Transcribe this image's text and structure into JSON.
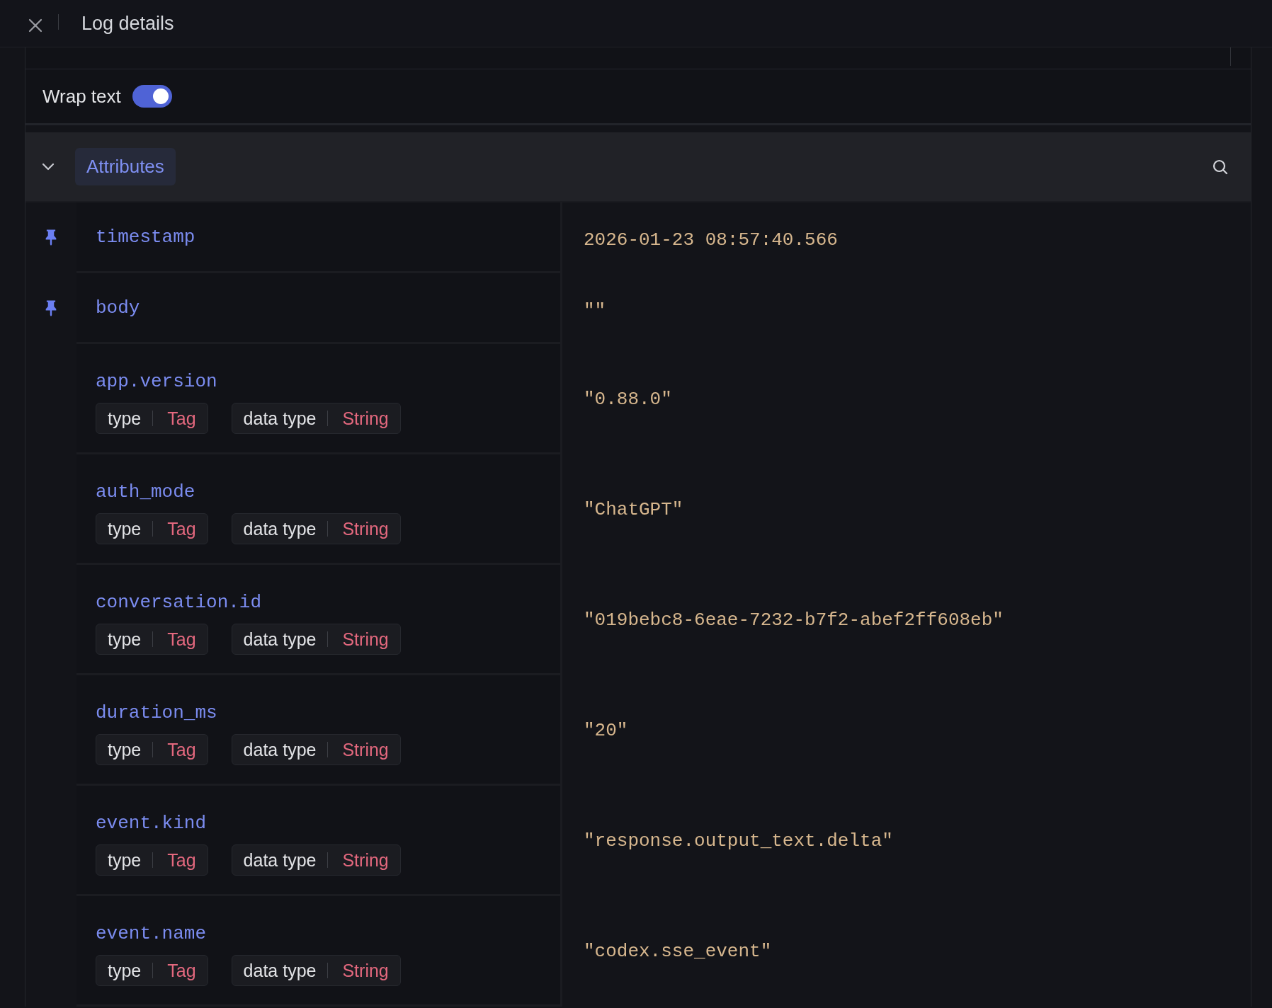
{
  "header": {
    "title": "Log details"
  },
  "wrap_text": {
    "label": "Wrap text",
    "on": true
  },
  "section": {
    "title": "Attributes",
    "expanded": true
  },
  "rows": [
    {
      "key": "timestamp",
      "value": "2026-01-23 08:57:40.566",
      "pinned": true
    },
    {
      "key": "body",
      "value": "\"\"",
      "pinned": true
    },
    {
      "key": "app.version",
      "value": "\"0.88.0\"",
      "pinned": false,
      "tags": [
        {
          "label": "type",
          "value": "Tag"
        },
        {
          "label": "data type",
          "value": "String"
        }
      ]
    },
    {
      "key": "auth_mode",
      "value": "\"ChatGPT\"",
      "pinned": false,
      "tags": [
        {
          "label": "type",
          "value": "Tag"
        },
        {
          "label": "data type",
          "value": "String"
        }
      ]
    },
    {
      "key": "conversation.id",
      "value": "\"019bebc8-6eae-7232-b7f2-abef2ff608eb\"",
      "pinned": false,
      "tags": [
        {
          "label": "type",
          "value": "Tag"
        },
        {
          "label": "data type",
          "value": "String"
        }
      ]
    },
    {
      "key": "duration_ms",
      "value": "\"20\"",
      "pinned": false,
      "tags": [
        {
          "label": "type",
          "value": "Tag"
        },
        {
          "label": "data type",
          "value": "String"
        }
      ]
    },
    {
      "key": "event.kind",
      "value": "\"response.output_text.delta\"",
      "pinned": false,
      "tags": [
        {
          "label": "type",
          "value": "Tag"
        },
        {
          "label": "data type",
          "value": "String"
        }
      ]
    },
    {
      "key": "event.name",
      "value": "\"codex.sse_event\"",
      "pinned": false,
      "tags": [
        {
          "label": "type",
          "value": "Tag"
        },
        {
          "label": "data type",
          "value": "String"
        }
      ]
    }
  ]
}
